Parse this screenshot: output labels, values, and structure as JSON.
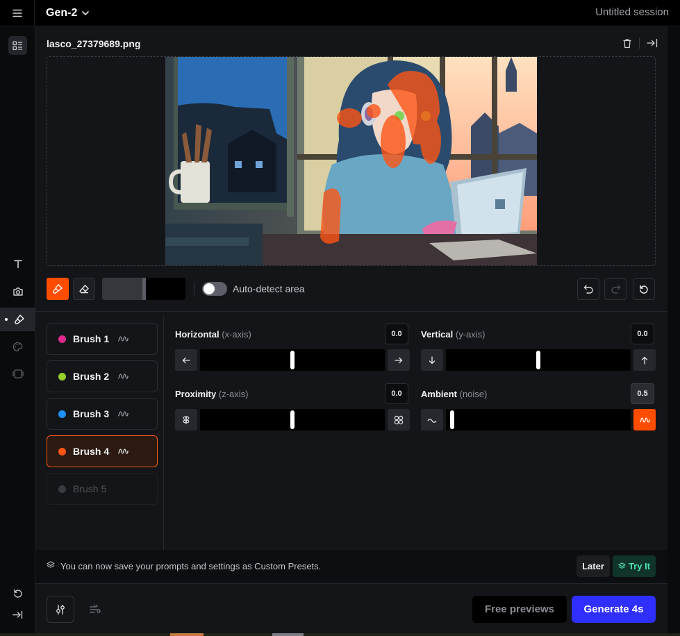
{
  "topbar": {
    "model": "Gen-2",
    "session": "Untitled session"
  },
  "file": {
    "name": "lasco_27379689.png"
  },
  "toolbar": {
    "auto_detect_label": "Auto-detect area",
    "auto_detect_on": false,
    "brush_size_fraction": 0.5
  },
  "brushes": [
    {
      "label": "Brush 1",
      "color": "#e22a8f",
      "state": "normal"
    },
    {
      "label": "Brush 2",
      "color": "#97d12c",
      "state": "normal"
    },
    {
      "label": "Brush 3",
      "color": "#1e90ff",
      "state": "normal"
    },
    {
      "label": "Brush 4",
      "color": "#ff5412",
      "state": "active"
    },
    {
      "label": "Brush 5",
      "color": "#5d5f68",
      "state": "disabled"
    }
  ],
  "sliders": {
    "horizontal": {
      "title": "Horizontal",
      "sub": "(x-axis)",
      "value": "0.0",
      "position": 0.5
    },
    "vertical": {
      "title": "Vertical",
      "sub": "(y-axis)",
      "value": "0.0",
      "position": 0.5
    },
    "proximity": {
      "title": "Proximity",
      "sub": "(z-axis)",
      "value": "0.0",
      "position": 0.5
    },
    "ambient": {
      "title": "Ambient",
      "sub": "(noise)",
      "value": "0.5",
      "position": 0.0
    }
  },
  "notice": {
    "text": "You can now save your prompts and settings as Custom Presets.",
    "later": "Later",
    "try": "Try It"
  },
  "footer": {
    "previews": "Free previews",
    "generate": "Generate 4s"
  },
  "colors": {
    "accent": "#ff4d00",
    "primary": "#2f2fff",
    "try_it": "#4fe0b0"
  }
}
